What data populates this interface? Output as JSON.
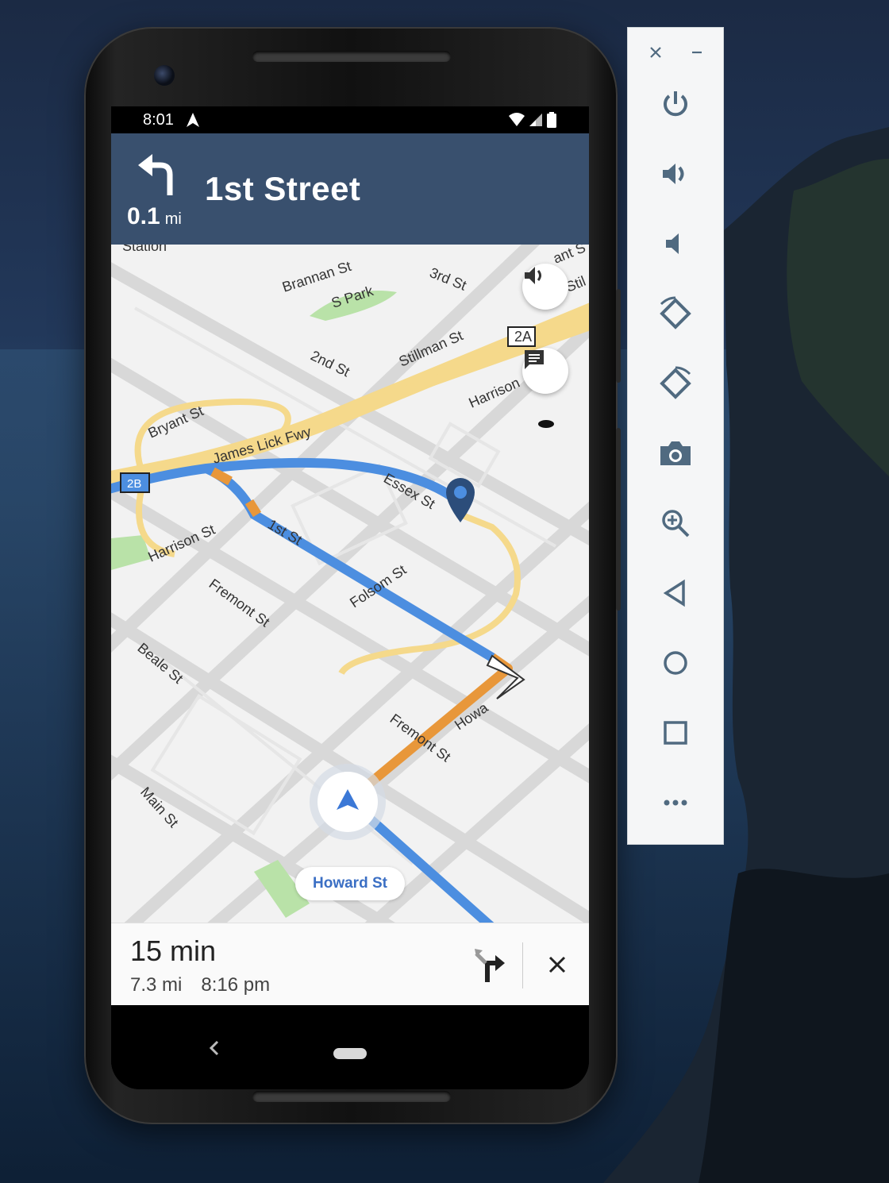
{
  "status_bar": {
    "time": "8:01"
  },
  "navigation": {
    "next_street": "1st Street",
    "distance_value": "0.1",
    "distance_unit": "mi"
  },
  "map": {
    "labels": {
      "station": "Station",
      "brannan": "Brannan St",
      "s_park": "S Park",
      "third": "3rd St",
      "bryant": "ant S",
      "stillman_short": "Stil",
      "stillman": "Stillman St",
      "second": "2nd St",
      "harrison_right": "Harrison",
      "bryant_st": "Bryant St",
      "james_lick": "James Lick Fwy",
      "essex": "Essex St",
      "harrison_left": "Harrison St",
      "first": "1st St",
      "folsom": "Folsom St",
      "fremont_upper": "Fremont St",
      "beale": "Beale St",
      "howard_route": "Howa",
      "fremont_lower": "Fremont St",
      "main": "Main St",
      "exit_2a": "2A",
      "exit_2b": "2B"
    },
    "current_road": "Howard St"
  },
  "trip": {
    "eta": "15 min",
    "distance": "7.3 mi",
    "arrival": "8:16 pm"
  },
  "colors": {
    "header_bg": "#39506e",
    "route_blue": "#4c8ee0",
    "traffic_orange": "#e8973a",
    "freeway_yellow": "#f5d98b"
  },
  "emulator_toolbar": {
    "icons": [
      "close-icon",
      "minimize-icon",
      "power-icon",
      "volume-up-icon",
      "volume-down-icon",
      "rotate-left-icon",
      "rotate-right-icon",
      "camera-icon",
      "zoom-icon",
      "back-icon",
      "home-icon",
      "overview-icon",
      "more-icon"
    ]
  }
}
